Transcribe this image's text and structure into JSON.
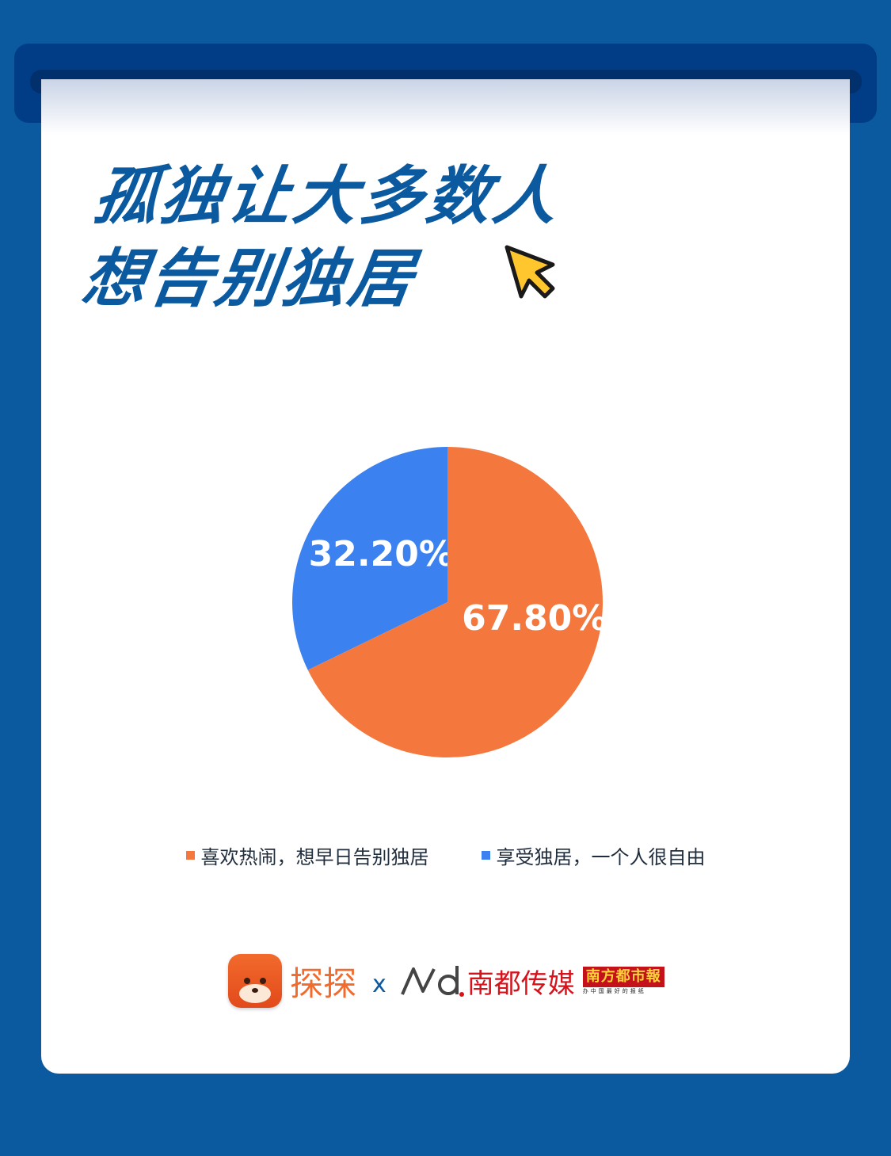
{
  "title": {
    "line1": "孤独让大多数人",
    "line2": "想告别独居"
  },
  "colors": {
    "background": "#0b5aa0",
    "accent": "#0b5aa0",
    "orange": "#f4783d",
    "blue": "#3b82f0"
  },
  "chart_data": {
    "type": "pie",
    "slices": [
      {
        "label": "享受独居，一个人很自由",
        "value": 32.2,
        "value_label": "32.20%",
        "color": "#3b82f0"
      },
      {
        "label": "喜欢热闹，想早日告别独居",
        "value": 67.8,
        "value_label": "67.80%",
        "color": "#f4783d"
      }
    ],
    "legend": [
      "喜欢热闹，想早日告别独居",
      "享受独居，一个人很自由"
    ],
    "legend_position": "bottom"
  },
  "legend_items": [
    {
      "label": "喜欢热闹，想早日告别独居",
      "color": "#f4783d"
    },
    {
      "label": "享受独居，一个人很自由",
      "color": "#3b82f0"
    }
  ],
  "footer": {
    "app_name": "探探",
    "cross": "x",
    "media_name": "南都传媒",
    "paper_name": "南方都市報",
    "paper_slogan": "办中国最好的报纸"
  }
}
